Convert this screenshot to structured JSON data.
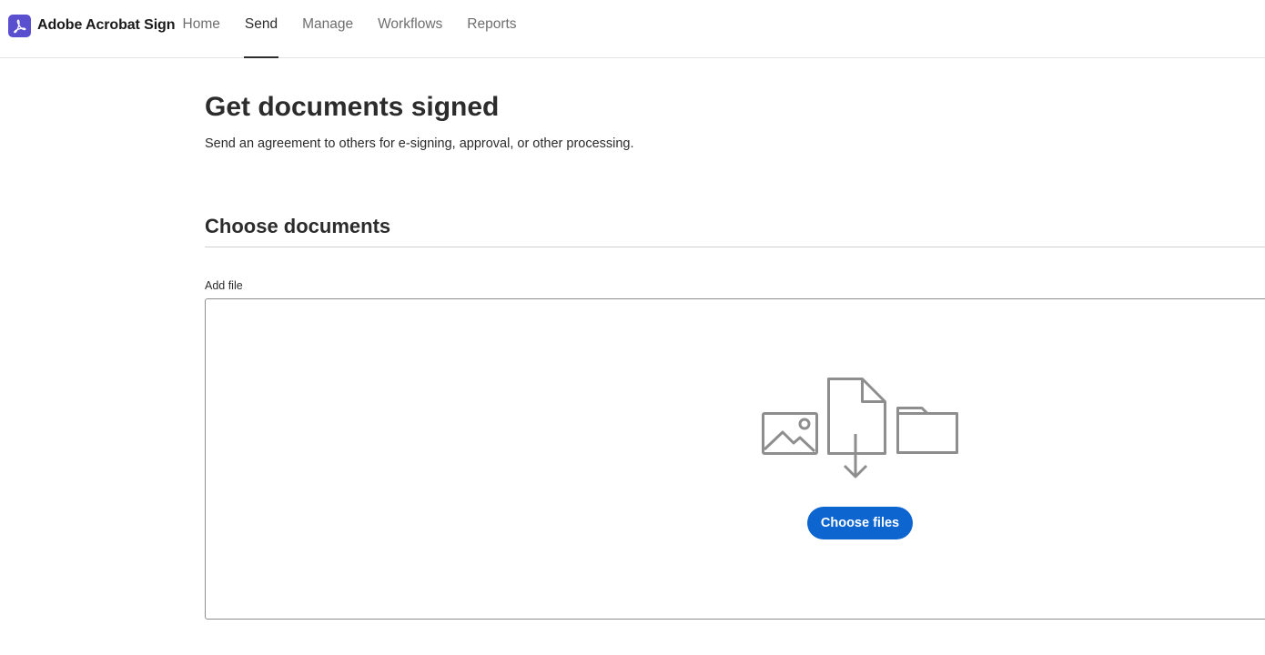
{
  "app": {
    "title": "Adobe Acrobat Sign",
    "logo_icon": "acrobat-logo-icon",
    "brand_color": "#5a4fcf"
  },
  "nav": {
    "tabs": [
      {
        "label": "Home",
        "active": false
      },
      {
        "label": "Send",
        "active": true
      },
      {
        "label": "Manage",
        "active": false
      },
      {
        "label": "Workflows",
        "active": false
      },
      {
        "label": "Reports",
        "active": false
      }
    ]
  },
  "page": {
    "title": "Get documents signed",
    "subtitle": "Send an agreement to others for e-signing, approval, or other processing."
  },
  "documents": {
    "section_title": "Choose documents",
    "add_file_label": "Add file",
    "dropzone_icons": [
      "image-icon",
      "file-download-icon",
      "folder-icon"
    ],
    "choose_button_label": "Choose files",
    "accent_color": "#0d66d0"
  }
}
